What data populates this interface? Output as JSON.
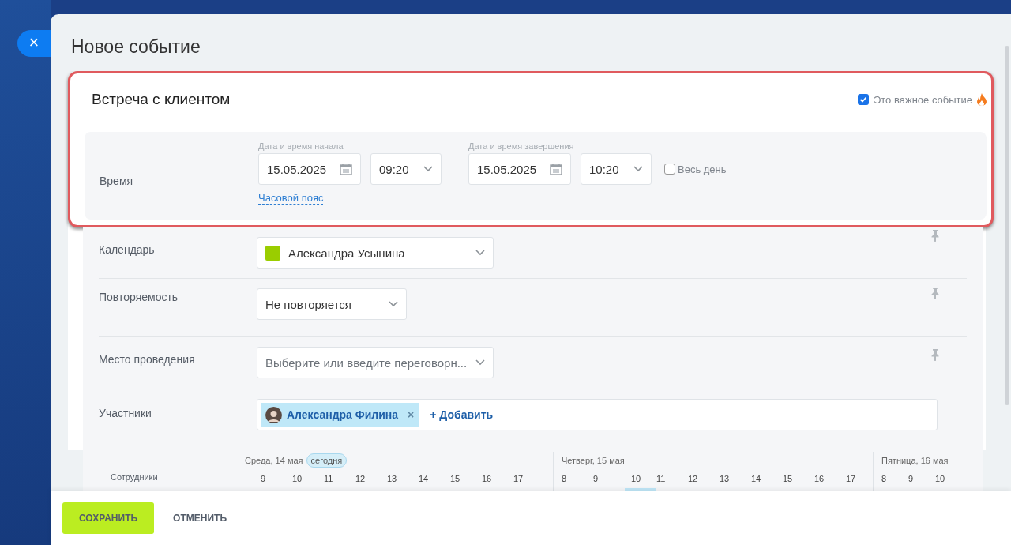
{
  "close_button": {
    "label": "×"
  },
  "dialog": {
    "title": "Новое событие"
  },
  "event": {
    "name": "Встреча с клиентом",
    "important": {
      "label": "Это важное событие",
      "checked": true
    }
  },
  "time": {
    "label": "Время",
    "start_caption": "Дата и время начала",
    "start_date": "15.05.2025",
    "start_time": "09:20",
    "separator": "—",
    "end_caption": "Дата и время завершения",
    "end_date": "15.05.2025",
    "end_time": "10:20",
    "all_day": {
      "label": "Весь день",
      "checked": false
    },
    "timezone_link": "Часовой пояс"
  },
  "fields": [
    {
      "kind": "calendar",
      "label": "Календарь",
      "value": "Александра Усынина",
      "color": "#9acd00",
      "pinned": true
    },
    {
      "kind": "select",
      "label": "Повторяемость",
      "value": "Не повторяется",
      "pinned": true
    },
    {
      "kind": "placeholder",
      "label": "Место проведения",
      "placeholder": "Выберите или введите переговорн...",
      "pinned": true
    },
    {
      "kind": "people",
      "label": "Участники",
      "people": [
        {
          "name": "Александра Филина",
          "remove": "×"
        }
      ],
      "add": "+ Добавить",
      "pinned": false
    }
  ],
  "planner": {
    "label": "Сотрудники",
    "days": [
      {
        "title": "Среда, 14 мая",
        "badge": "сегодня",
        "hours": [
          {
            "label": "9",
            "selected": false
          },
          {
            "label": "10",
            "selected": false
          },
          {
            "label": "11",
            "selected": false
          },
          {
            "label": "12",
            "selected": false
          },
          {
            "label": "13",
            "selected": false
          },
          {
            "label": "14",
            "selected": false
          },
          {
            "label": "15",
            "selected": false
          },
          {
            "label": "16",
            "selected": false
          },
          {
            "label": "17",
            "selected": false
          }
        ]
      },
      {
        "title": "Четверг, 15 мая",
        "hours": [
          {
            "label": "8",
            "selected": false
          },
          {
            "label": "9",
            "selected": false
          },
          {
            "label": "10",
            "selected": true
          },
          {
            "label": "11",
            "selected": false
          },
          {
            "label": "12",
            "selected": false
          },
          {
            "label": "13",
            "selected": false
          },
          {
            "label": "14",
            "selected": false
          },
          {
            "label": "15",
            "selected": false
          },
          {
            "label": "16",
            "selected": false
          },
          {
            "label": "17",
            "selected": false
          }
        ]
      },
      {
        "title": "Пятница, 16 мая",
        "hours": [
          {
            "label": "8",
            "selected": false
          },
          {
            "label": "9",
            "selected": false
          },
          {
            "label": "10",
            "selected": false
          }
        ]
      }
    ]
  },
  "footer": {
    "save": "СОХРАНИТЬ",
    "cancel": "ОТМЕНИТЬ"
  }
}
